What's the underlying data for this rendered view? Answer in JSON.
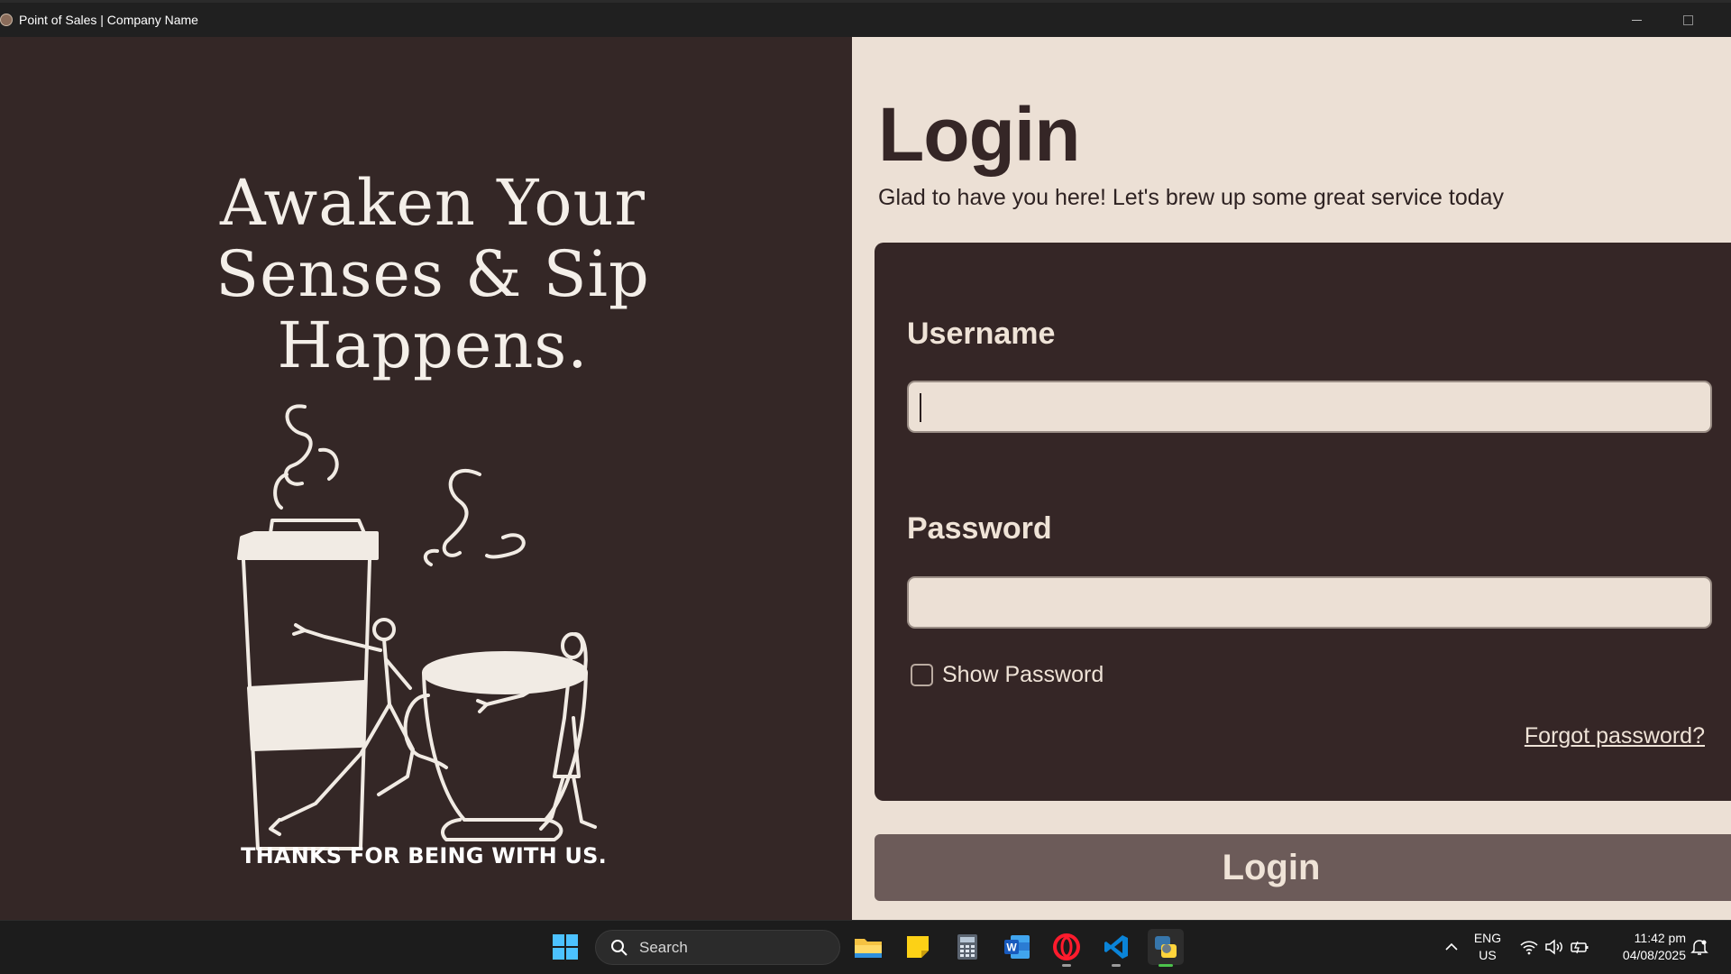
{
  "window": {
    "title": "Point of Sales | Company Name"
  },
  "left": {
    "tagline": "Awaken Your Senses & Sip Happens.",
    "thanks": "THANKS FOR BEING WITH US."
  },
  "login": {
    "heading": "Login",
    "subtitle": "Glad to have you here! Let's brew up some great service today",
    "username_label": "Username",
    "username_value": "",
    "password_label": "Password",
    "password_value": "",
    "show_password_label": "Show Password",
    "show_password_checked": false,
    "forgot_label": "Forgot password?",
    "button_label": "Login"
  },
  "taskbar": {
    "search_placeholder": "Search",
    "apps": [
      "start-icon",
      "file-explorer-icon",
      "sticky-notes-icon",
      "calculator-icon",
      "word-icon",
      "opera-icon",
      "vscode-icon",
      "python-icon"
    ],
    "language": "ENG",
    "region": "US",
    "time": "11:42 pm",
    "date": "04/08/2025"
  },
  "colors": {
    "panel_dark": "#342726",
    "panel_light": "#ece0d5",
    "button": "#6c5b59",
    "text_light": "#efe3d7"
  }
}
